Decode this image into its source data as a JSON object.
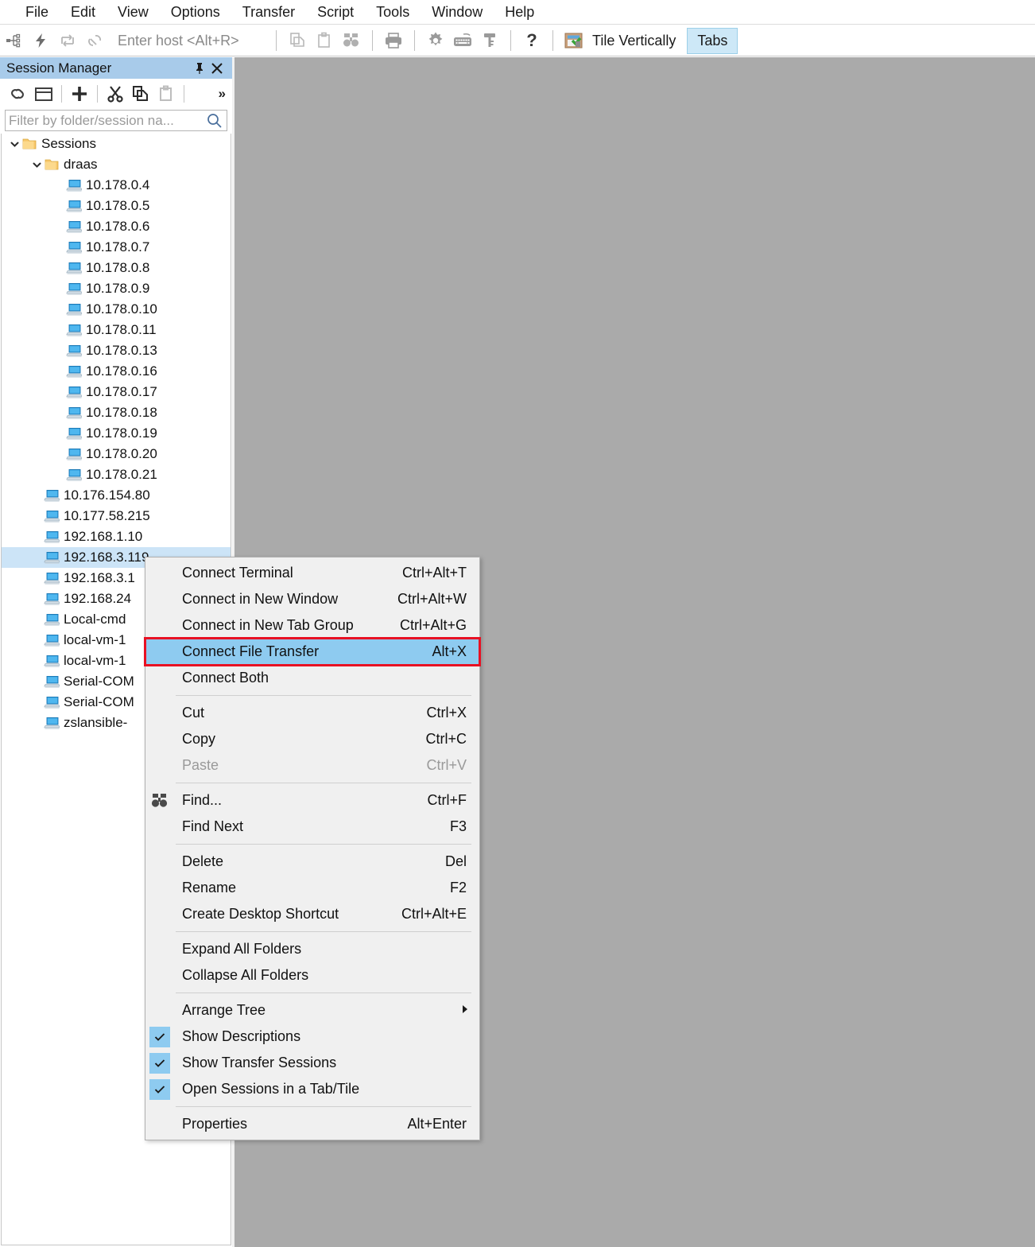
{
  "menubar": {
    "items": [
      {
        "label": "File"
      },
      {
        "label": "Edit"
      },
      {
        "label": "View"
      },
      {
        "label": "Options"
      },
      {
        "label": "Transfer"
      },
      {
        "label": "Script"
      },
      {
        "label": "Tools"
      },
      {
        "label": "Window"
      },
      {
        "label": "Help"
      }
    ]
  },
  "toolbar": {
    "host_entry_placeholder": "Enter host <Alt+R>",
    "tile_vertically_label": "Tile Vertically",
    "tabs_label": "Tabs",
    "icons": [
      "connect-tree-icon",
      "quick-connect-icon",
      "reconnect-icon",
      "disconnect-icon",
      "copy-icon",
      "paste-icon",
      "find-icon",
      "print-icon",
      "settings-gear-icon",
      "keyboard-icon",
      "key-icon",
      "help-question-icon",
      "tile-vertically-icon"
    ]
  },
  "session_manager": {
    "title": "Session Manager",
    "pin_glyph": "📌",
    "close_glyph": "✕",
    "filter_placeholder": "Filter by folder/session na...",
    "overflow_glyph": "»",
    "toolbar_icons": [
      "link-icon",
      "new-window-icon",
      "add-icon",
      "cut-icon",
      "copy-icon",
      "paste-icon"
    ],
    "tree": [
      {
        "label": "Sessions",
        "type": "folder",
        "depth": 0,
        "expanded": true,
        "selected": false
      },
      {
        "label": "draas",
        "type": "folder",
        "depth": 1,
        "expanded": true,
        "selected": false
      },
      {
        "label": "10.178.0.4",
        "type": "session",
        "depth": 2,
        "selected": false
      },
      {
        "label": "10.178.0.5",
        "type": "session",
        "depth": 2,
        "selected": false
      },
      {
        "label": "10.178.0.6",
        "type": "session",
        "depth": 2,
        "selected": false
      },
      {
        "label": "10.178.0.7",
        "type": "session",
        "depth": 2,
        "selected": false
      },
      {
        "label": "10.178.0.8",
        "type": "session",
        "depth": 2,
        "selected": false
      },
      {
        "label": "10.178.0.9",
        "type": "session",
        "depth": 2,
        "selected": false
      },
      {
        "label": "10.178.0.10",
        "type": "session",
        "depth": 2,
        "selected": false
      },
      {
        "label": "10.178.0.11",
        "type": "session",
        "depth": 2,
        "selected": false
      },
      {
        "label": "10.178.0.13",
        "type": "session",
        "depth": 2,
        "selected": false
      },
      {
        "label": "10.178.0.16",
        "type": "session",
        "depth": 2,
        "selected": false
      },
      {
        "label": "10.178.0.17",
        "type": "session",
        "depth": 2,
        "selected": false
      },
      {
        "label": "10.178.0.18",
        "type": "session",
        "depth": 2,
        "selected": false
      },
      {
        "label": "10.178.0.19",
        "type": "session",
        "depth": 2,
        "selected": false
      },
      {
        "label": "10.178.0.20",
        "type": "session",
        "depth": 2,
        "selected": false
      },
      {
        "label": "10.178.0.21",
        "type": "session",
        "depth": 2,
        "selected": false
      },
      {
        "label": "10.176.154.80",
        "type": "session",
        "depth": 1,
        "selected": false
      },
      {
        "label": "10.177.58.215",
        "type": "session",
        "depth": 1,
        "selected": false
      },
      {
        "label": "192.168.1.10",
        "type": "session",
        "depth": 1,
        "selected": false
      },
      {
        "label": "192.168.3.119",
        "type": "session",
        "depth": 1,
        "selected": true
      },
      {
        "label": "192.168.3.1",
        "type": "session",
        "depth": 1,
        "selected": false
      },
      {
        "label": "192.168.24",
        "type": "session",
        "depth": 1,
        "selected": false
      },
      {
        "label": "Local-cmd",
        "type": "session",
        "depth": 1,
        "selected": false
      },
      {
        "label": "local-vm-1",
        "type": "session",
        "depth": 1,
        "selected": false
      },
      {
        "label": "local-vm-1",
        "type": "session",
        "depth": 1,
        "selected": false
      },
      {
        "label": "Serial-COM",
        "type": "session",
        "depth": 1,
        "selected": false
      },
      {
        "label": "Serial-COM",
        "type": "session",
        "depth": 1,
        "selected": false
      },
      {
        "label": "zslansible-",
        "type": "session",
        "depth": 1,
        "selected": false
      }
    ]
  },
  "context_menu": {
    "items": [
      {
        "kind": "item",
        "label": "Connect Terminal",
        "accel": "Ctrl+Alt+T"
      },
      {
        "kind": "item",
        "label": "Connect in New Window",
        "accel": "Ctrl+Alt+W"
      },
      {
        "kind": "item",
        "label": "Connect in New Tab Group",
        "accel": "Ctrl+Alt+G"
      },
      {
        "kind": "item",
        "label": "Connect File Transfer",
        "accel": "Alt+X",
        "highlight": true,
        "redbox": true
      },
      {
        "kind": "item",
        "label": "Connect Both",
        "accel": ""
      },
      {
        "kind": "sep"
      },
      {
        "kind": "item",
        "label": "Cut",
        "accel": "Ctrl+X"
      },
      {
        "kind": "item",
        "label": "Copy",
        "accel": "Ctrl+C"
      },
      {
        "kind": "item",
        "label": "Paste",
        "accel": "Ctrl+V",
        "disabled": true
      },
      {
        "kind": "sep"
      },
      {
        "kind": "item",
        "label": "Find...",
        "accel": "Ctrl+F",
        "icon": "find-binoculars-icon"
      },
      {
        "kind": "item",
        "label": "Find Next",
        "accel": "F3"
      },
      {
        "kind": "sep"
      },
      {
        "kind": "item",
        "label": "Delete",
        "accel": "Del"
      },
      {
        "kind": "item",
        "label": "Rename",
        "accel": "F2"
      },
      {
        "kind": "item",
        "label": "Create Desktop Shortcut",
        "accel": "Ctrl+Alt+E"
      },
      {
        "kind": "sep"
      },
      {
        "kind": "item",
        "label": "Expand All Folders",
        "accel": ""
      },
      {
        "kind": "item",
        "label": "Collapse All Folders",
        "accel": ""
      },
      {
        "kind": "sep"
      },
      {
        "kind": "item",
        "label": "Arrange Tree",
        "accel": "",
        "submenu": true
      },
      {
        "kind": "item",
        "label": "Show Descriptions",
        "accel": "",
        "checked": true
      },
      {
        "kind": "item",
        "label": "Show Transfer Sessions",
        "accel": "",
        "checked": true
      },
      {
        "kind": "item",
        "label": "Open Sessions in a Tab/Tile",
        "accel": "",
        "checked": true
      },
      {
        "kind": "sep"
      },
      {
        "kind": "item",
        "label": "Properties",
        "accel": "Alt+Enter"
      }
    ]
  },
  "colors": {
    "header_blue": "#a8cbea",
    "selection_blue": "#cce4f7",
    "menu_highlight_blue": "#8ecbf0",
    "red_annotation": "#e81123",
    "workspace_gray": "#aaaaaa",
    "menu_background": "#f0f0f0"
  }
}
